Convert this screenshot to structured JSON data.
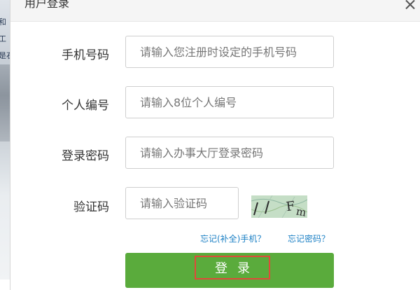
{
  "dialog": {
    "title": "用户登录"
  },
  "backdrop": {
    "text_lines": [
      "和",
      "工",
      "是石"
    ]
  },
  "form": {
    "phone": {
      "label": "手机号码",
      "placeholder": "请输入您注册时设定的手机号码",
      "value": ""
    },
    "personal_id": {
      "label": "个人编号",
      "placeholder": "请输入8位个人编号",
      "value": ""
    },
    "password": {
      "label": "登录密码",
      "placeholder": "请输入办事大厅登录密码",
      "value": ""
    },
    "captcha": {
      "label": "验证码",
      "placeholder": "请输入验证码",
      "value": "",
      "image_text": "l l Fm"
    }
  },
  "links": {
    "forgot_phone": "忘记(补全)手机？",
    "forgot_password": "忘记密码？"
  },
  "login_button": {
    "label": "登录"
  },
  "colors": {
    "accent_green": "#5aab3c",
    "link_blue": "#1a7fc4",
    "highlight_red": "#e0493a"
  }
}
